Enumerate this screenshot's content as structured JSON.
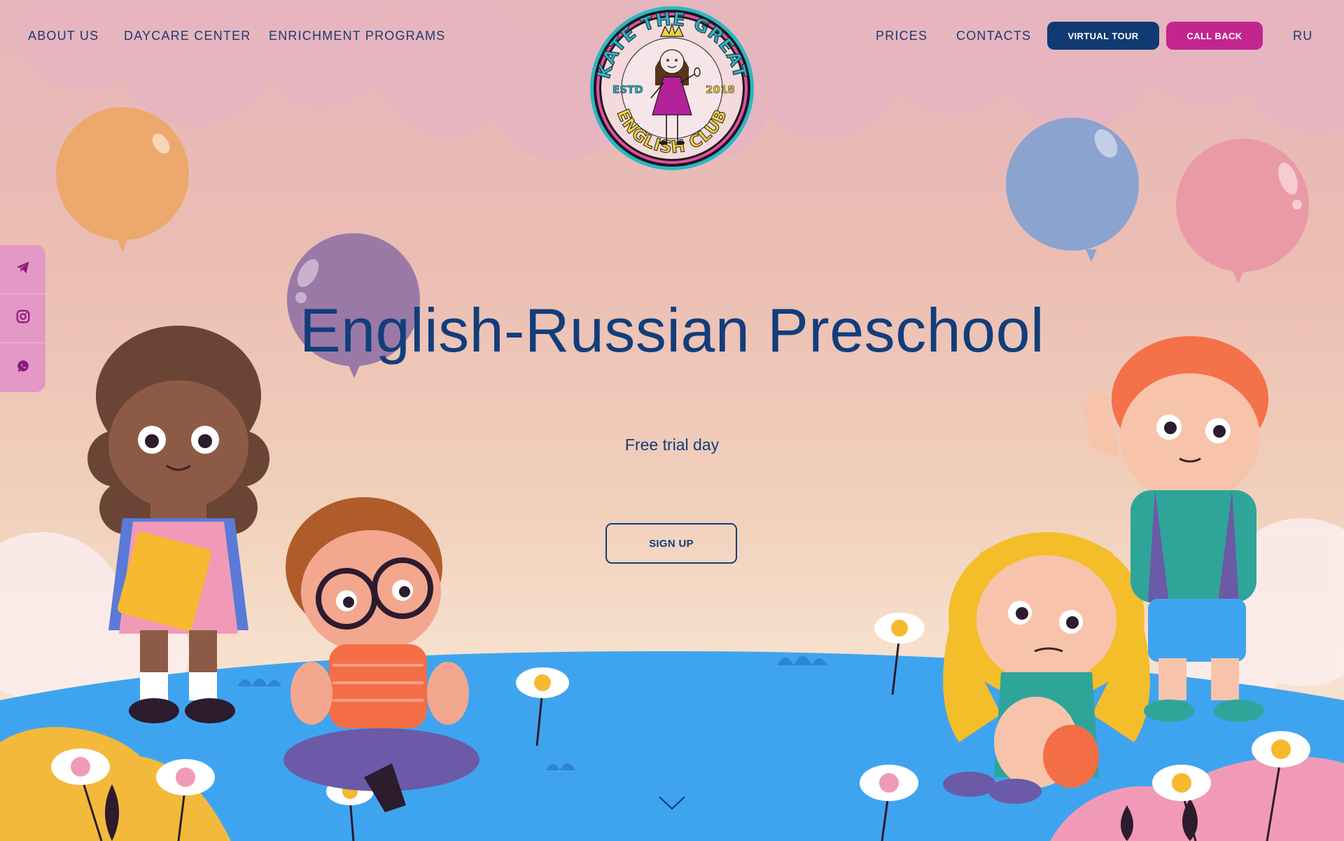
{
  "header": {
    "nav_left": [
      {
        "label": "ABOUT US"
      },
      {
        "label": "DAYCARE CENTER"
      },
      {
        "label": "ENRICHMENT PROGRAMS"
      }
    ],
    "nav_right": [
      {
        "label": "PRICES"
      },
      {
        "label": "CONTACTS"
      }
    ],
    "virtual_tour_label": "VIRTUAL TOUR",
    "call_back_label": "CALL BACK",
    "language_label": "RU"
  },
  "logo": {
    "top_text": "KATE THE GREAT",
    "bottom_text": "ENGLISH CLUB",
    "left_text": "ESTD",
    "right_text": "2018"
  },
  "social": [
    {
      "icon": "telegram-icon"
    },
    {
      "icon": "instagram-icon"
    },
    {
      "icon": "whatsapp-icon"
    }
  ],
  "hero": {
    "title": "English-Russian Preschool",
    "subtitle": "Free trial day",
    "signup_label": "SIGN UP"
  },
  "colors": {
    "navy": "#123d7b",
    "magenta": "#c3258f",
    "social_bar": "#e398c6",
    "ground": "#3fa4ef"
  }
}
